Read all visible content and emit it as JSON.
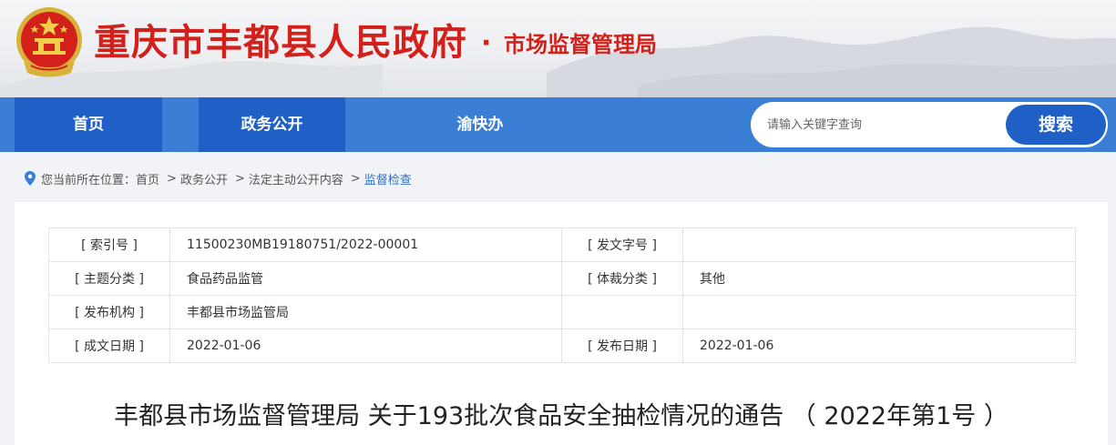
{
  "header": {
    "title": "重庆市丰都县人民政府",
    "dot": "·",
    "subtitle": "市场监督管理局",
    "emblem_icon": "national-emblem-icon"
  },
  "nav": {
    "items": [
      {
        "label": "首页"
      },
      {
        "label": "政务公开"
      },
      {
        "label": "渝快办"
      }
    ],
    "search": {
      "placeholder": "请输入关键字查询",
      "button_label": "搜索"
    }
  },
  "breadcrumb": {
    "prefix": "您当前所在位置：",
    "items": [
      "首页",
      "政务公开",
      "法定主动公开内容"
    ],
    "current": "监督检查",
    "separator": ">"
  },
  "meta": {
    "rows": [
      {
        "label1": "[ 索引号 ]",
        "value1": "11500230MB19180751/2022-00001",
        "label2": "[ 发文字号 ]",
        "value2": ""
      },
      {
        "label1": "[ 主题分类 ]",
        "value1": "食品药品监管",
        "label2": "[ 体裁分类 ]",
        "value2": "其他"
      },
      {
        "label1": "[ 发布机构 ]",
        "value1": "丰都县市场监管局",
        "label2": "",
        "value2": ""
      },
      {
        "label1": "[ 成文日期 ]",
        "value1": "2022-01-06",
        "label2": "[ 发布日期 ]",
        "value2": "2022-01-06"
      }
    ]
  },
  "document": {
    "title": "丰都县市场监督管理局 关于193批次食品安全抽检情况的通告 （ 2022年第1号 ）"
  },
  "colors": {
    "title_red": "#d3201a",
    "nav_blue": "#3a7fd5",
    "nav_active": "#1f60c6",
    "breadcrumb_current": "#2f6fc2"
  }
}
